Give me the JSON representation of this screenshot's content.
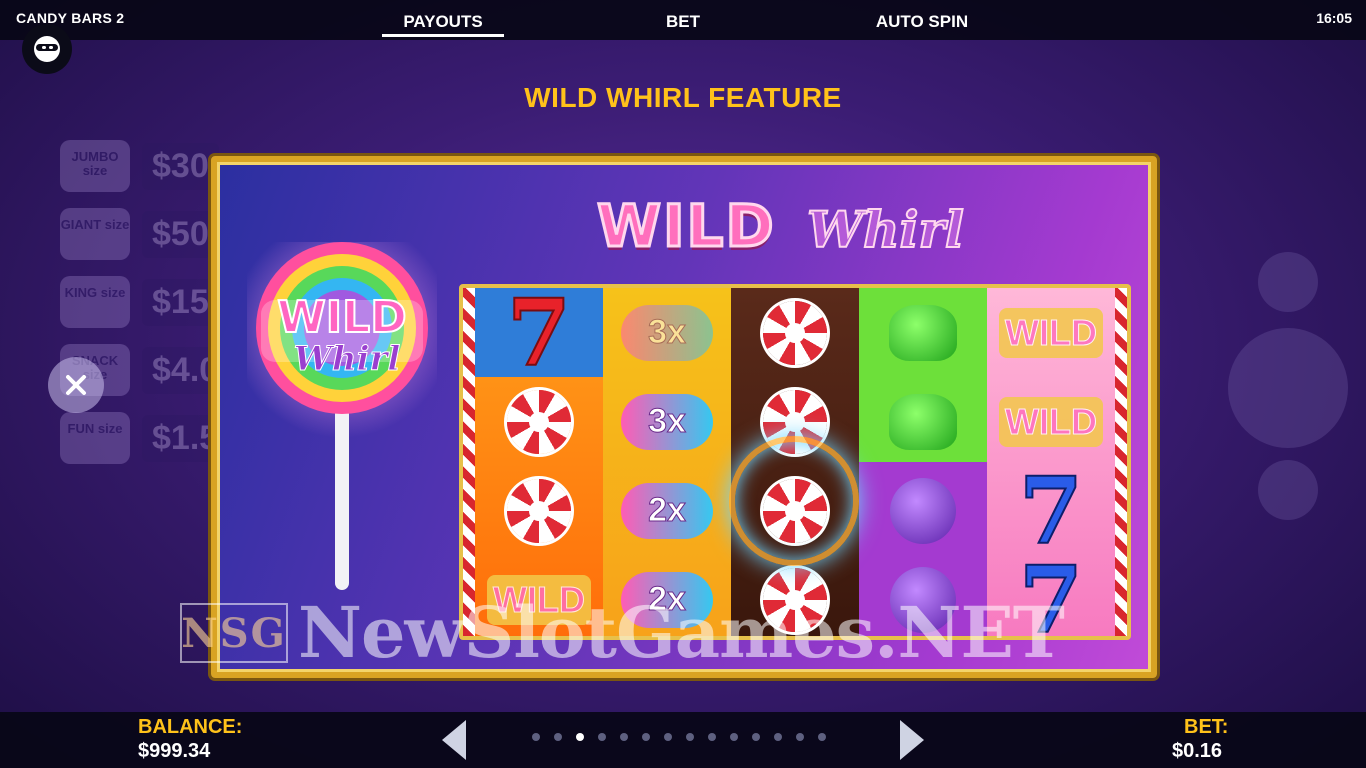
{
  "header": {
    "game_title": "CANDY BARS 2",
    "clock": "16:05",
    "tabs": [
      {
        "label": "PAYOUTS",
        "active": true
      },
      {
        "label": "BET",
        "active": false
      },
      {
        "label": "AUTO SPIN",
        "active": false
      }
    ]
  },
  "feature": {
    "title": "WILD WHIRL FEATURE",
    "logo_wild": "WILD",
    "logo_whirl": "Whirl",
    "lollipop_wild": "WILD",
    "lollipop_whirl": "Whirl"
  },
  "background_paytable": [
    {
      "size": "JUMBO size",
      "value": "$30"
    },
    {
      "size": "GIANT size",
      "value": "$50"
    },
    {
      "size": "KING size",
      "value": "$15"
    },
    {
      "size": "SNACK size",
      "value": "$4.0"
    },
    {
      "size": "FUN size",
      "value": "$1.5"
    }
  ],
  "reels": [
    [
      "7",
      "mint",
      "mint",
      "WILD"
    ],
    [
      "3x",
      "3x",
      "2x",
      "2x"
    ],
    [
      "mint",
      "mint",
      "mint",
      "mint"
    ],
    [
      "gummy",
      "gummy",
      "grape",
      "grape"
    ],
    [
      "WILD",
      "WILD",
      "7",
      "7"
    ]
  ],
  "watermark": {
    "logo": "NSG",
    "text": "NewSlotGames.NET"
  },
  "footer": {
    "balance_label": "BALANCE:",
    "balance_value": "$999.34",
    "bet_label": "BET:",
    "bet_value": "$0.16",
    "page_count": 14,
    "current_page": 3
  },
  "colors": {
    "accent_yellow": "#ffc21a",
    "frame_gold": "#d9a323",
    "bar_bg": "#08061a"
  },
  "icons": [
    "ninja-avatar-icon",
    "close-icon",
    "arrow-left-icon",
    "arrow-right-icon"
  ]
}
